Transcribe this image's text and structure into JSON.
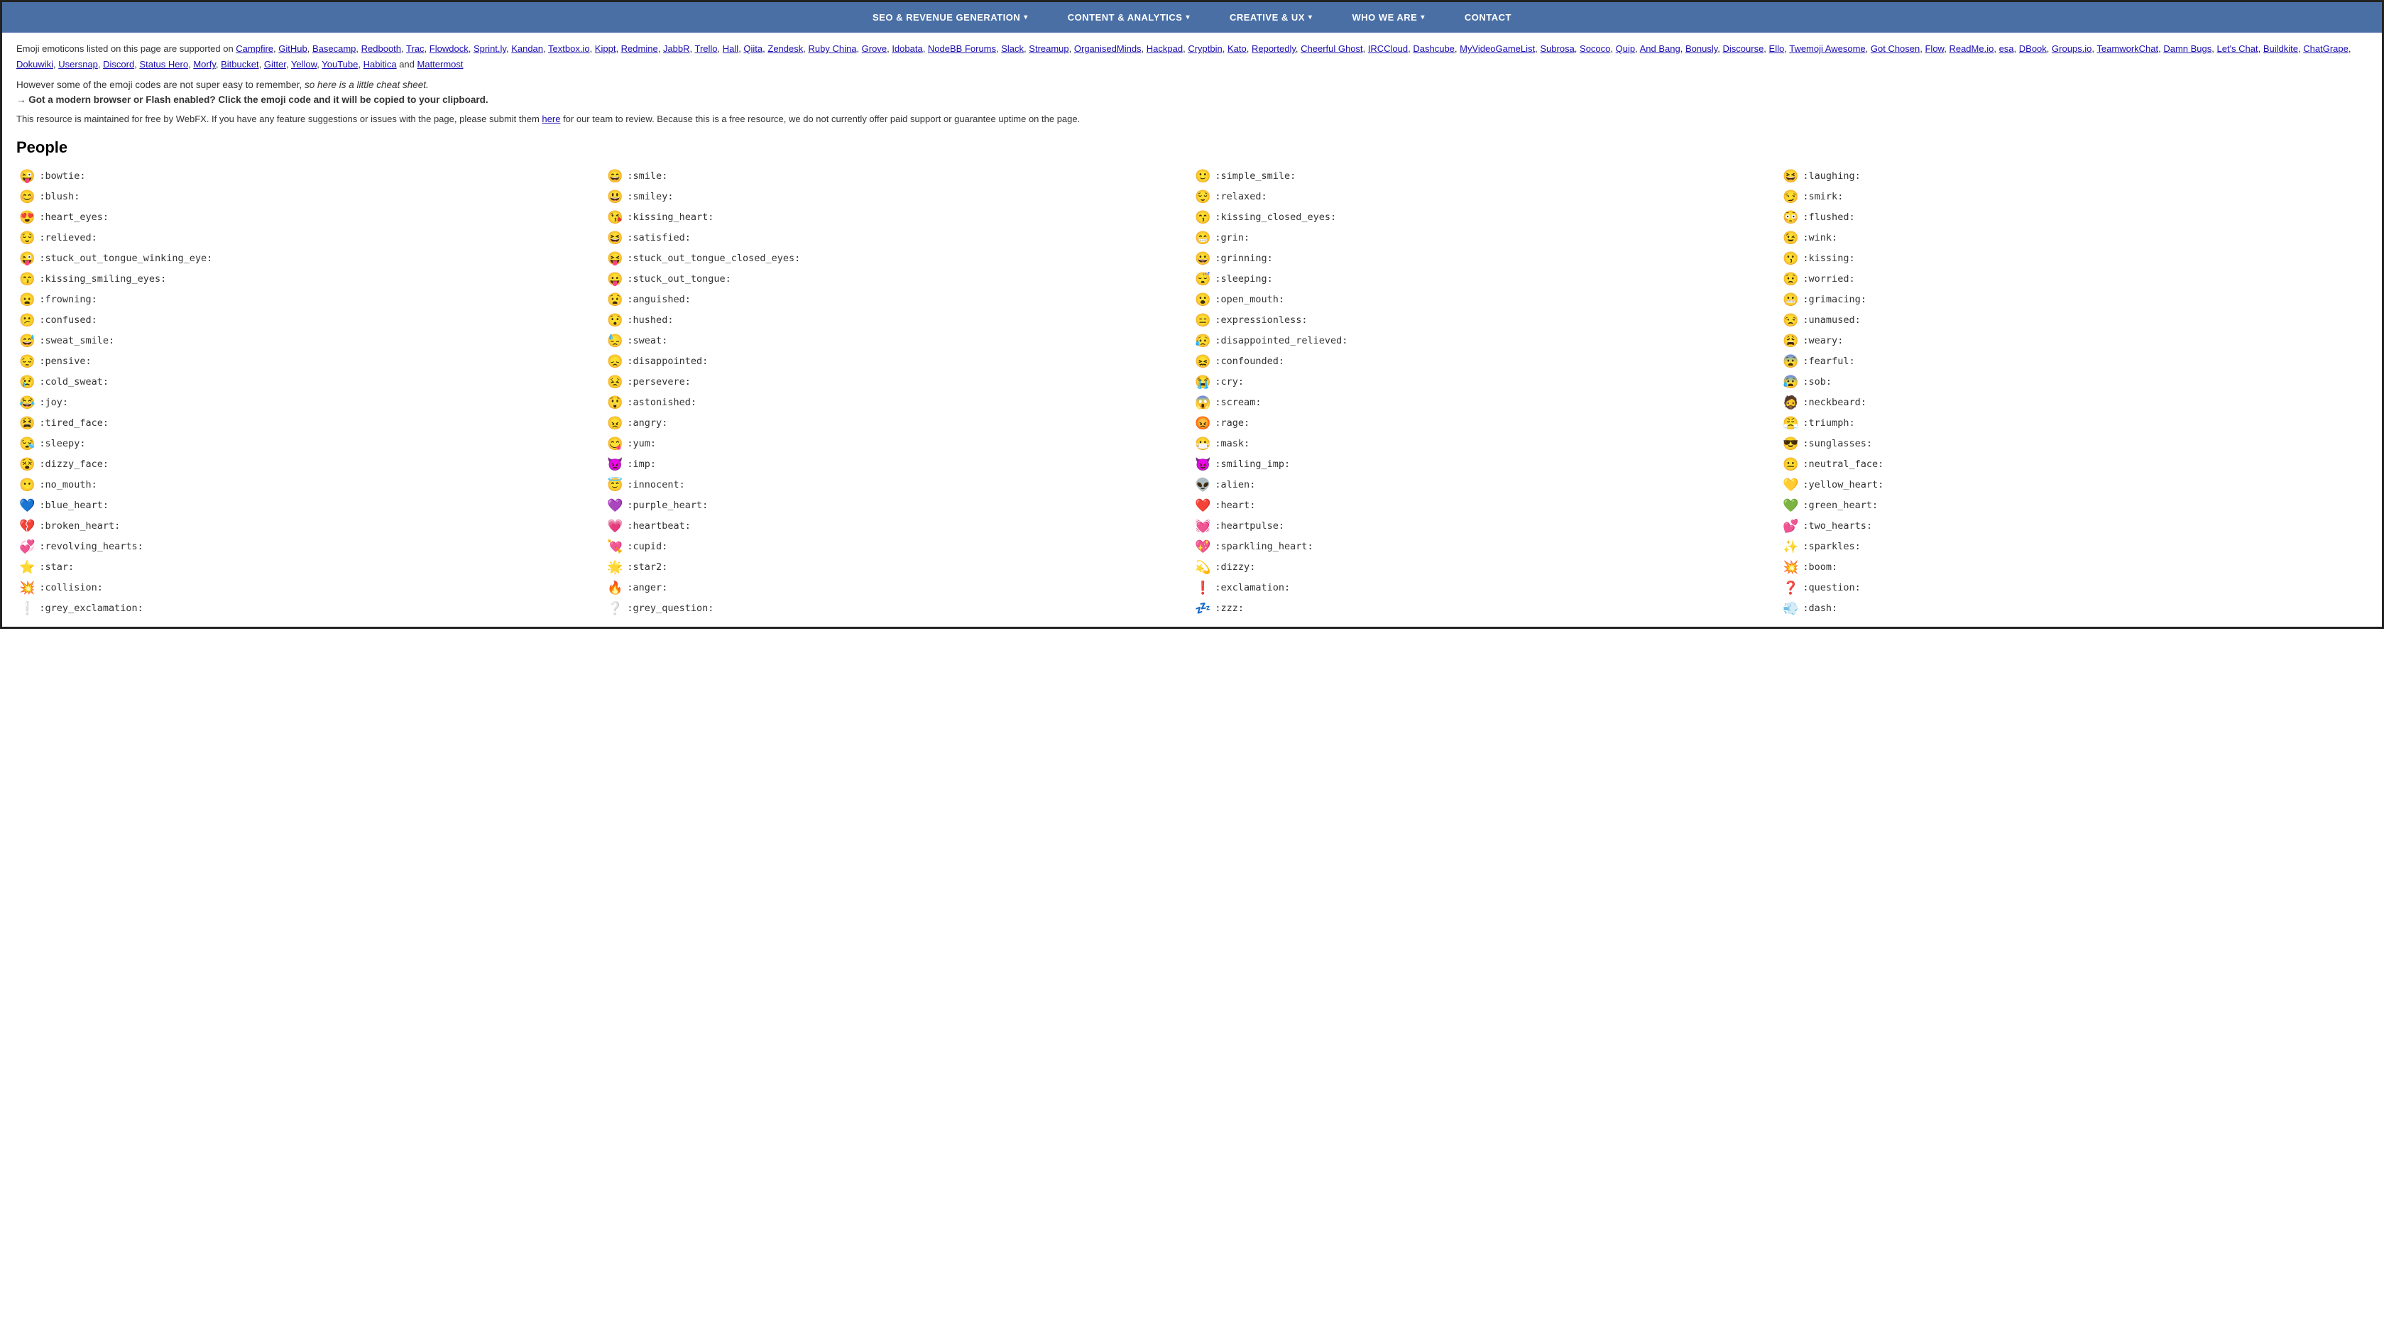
{
  "nav": {
    "items": [
      {
        "label": "SEO & REVENUE GENERATION",
        "has_dropdown": true
      },
      {
        "label": "CONTENT & ANALYTICS",
        "has_dropdown": true
      },
      {
        "label": "CREATIVE & UX",
        "has_dropdown": true
      },
      {
        "label": "WHO WE ARE",
        "has_dropdown": true
      },
      {
        "label": "CONTACT",
        "has_dropdown": false
      }
    ]
  },
  "intro": {
    "prefix": "Emoji emoticons listed on this page are supported on",
    "links": [
      "Campfire",
      "GitHub",
      "Basecamp",
      "Redbooth",
      "Trac",
      "Flowdock",
      "Sprint.ly",
      "Kandan",
      "Textbox.io",
      "Kippt",
      "Redmine",
      "JabbR",
      "Trello",
      "Hall",
      "Qiita",
      "Zendesk",
      "Ruby China",
      "Grove",
      "Idobata",
      "NodeBB Forums",
      "Slack",
      "Streamup",
      "OrganisedMinds",
      "Hackpad",
      "Cryptbin",
      "Kato",
      "Reportedly",
      "Cheerful Ghost",
      "IRCCloud",
      "Dashcube",
      "MyVideoGameList",
      "Subrosa",
      "Sococo",
      "Quip",
      "And Bang",
      "Bonusly",
      "Discourse",
      "Ello",
      "Twemoji Awesome",
      "Got Chosen",
      "Flow",
      "ReadMe.io",
      "esa",
      "DBook",
      "Groups.io",
      "TeamworkChat",
      "Damn Bugs",
      "Let's Chat",
      "Buildkite",
      "ChatGrape",
      "Dokuwiki",
      "Usersnap",
      "Discord",
      "Status Hero",
      "Morfy",
      "Bitbucket",
      "Gitter",
      "Yellow",
      "YouTube",
      "Habitica",
      "Mattermost"
    ],
    "cheat_note": "However some of the emoji codes are not super easy to remember,",
    "cheat_italic": "so here is a little cheat sheet.",
    "arrow_text": "Got a modern browser or Flash enabled? Click the emoji code and it will be copied to your clipboard.",
    "resource_text": "This resource is maintained for free by WebFX. If you have any feature suggestions or issues with the page, please submit them",
    "resource_link_text": "here",
    "resource_suffix": "for our team to review. Because this is a free resource, we do not currently offer paid support or guarantee uptime on the page."
  },
  "section": {
    "title": "People"
  },
  "emojis": [
    {
      "em": "😜",
      "code": ":bowtie:"
    },
    {
      "em": "😄",
      "code": ":smile:"
    },
    {
      "em": "🙂",
      "code": ":simple_smile:"
    },
    {
      "em": "😆",
      "code": ":laughing:"
    },
    {
      "em": "😊",
      "code": ":blush:"
    },
    {
      "em": "😃",
      "code": ":smiley:"
    },
    {
      "em": "😌",
      "code": ":relaxed:"
    },
    {
      "em": "😏",
      "code": ":smirk:"
    },
    {
      "em": "😍",
      "code": ":heart_eyes:"
    },
    {
      "em": "😘",
      "code": ":kissing_heart:"
    },
    {
      "em": "😙",
      "code": ":kissing_closed_eyes:"
    },
    {
      "em": "😳",
      "code": ":flushed:"
    },
    {
      "em": "😌",
      "code": ":relieved:"
    },
    {
      "em": "😆",
      "code": ":satisfied:"
    },
    {
      "em": "😁",
      "code": ":grin:"
    },
    {
      "em": "😉",
      "code": ":wink:"
    },
    {
      "em": "😜",
      "code": ":stuck_out_tongue_winking_eye:"
    },
    {
      "em": "😝",
      "code": ":stuck_out_tongue_closed_eyes:"
    },
    {
      "em": "😀",
      "code": ":grinning:"
    },
    {
      "em": "😗",
      "code": ":kissing:"
    },
    {
      "em": "😙",
      "code": ":kissing_smiling_eyes:"
    },
    {
      "em": "😛",
      "code": ":stuck_out_tongue:"
    },
    {
      "em": "😴",
      "code": ":sleeping:"
    },
    {
      "em": "😟",
      "code": ":worried:"
    },
    {
      "em": "😦",
      "code": ":frowning:"
    },
    {
      "em": "😧",
      "code": ":anguished:"
    },
    {
      "em": "😮",
      "code": ":open_mouth:"
    },
    {
      "em": "😬",
      "code": ":grimacing:"
    },
    {
      "em": "😕",
      "code": ":confused:"
    },
    {
      "em": "😯",
      "code": ":hushed:"
    },
    {
      "em": "😑",
      "code": ":expressionless:"
    },
    {
      "em": "😒",
      "code": ":unamused:"
    },
    {
      "em": "😅",
      "code": ":sweat_smile:"
    },
    {
      "em": "😓",
      "code": ":sweat:"
    },
    {
      "em": "😥",
      "code": ":disappointed_relieved:"
    },
    {
      "em": "😩",
      "code": ":weary:"
    },
    {
      "em": "😔",
      "code": ":pensive:"
    },
    {
      "em": "😞",
      "code": ":disappointed:"
    },
    {
      "em": "😖",
      "code": ":confounded:"
    },
    {
      "em": "😨",
      "code": ":fearful:"
    },
    {
      "em": "😢",
      "code": ":cold_sweat:"
    },
    {
      "em": "😣",
      "code": ":persevere:"
    },
    {
      "em": "😭",
      "code": ":cry:"
    },
    {
      "em": "😰",
      "code": ":sob:"
    },
    {
      "em": "😂",
      "code": ":joy:"
    },
    {
      "em": "😲",
      "code": ":astonished:"
    },
    {
      "em": "😱",
      "code": ":scream:"
    },
    {
      "em": "🧔",
      "code": ":neckbeard:"
    },
    {
      "em": "😫",
      "code": ":tired_face:"
    },
    {
      "em": "😠",
      "code": ":angry:"
    },
    {
      "em": "😡",
      "code": ":rage:"
    },
    {
      "em": "😤",
      "code": ":triumph:"
    },
    {
      "em": "😪",
      "code": ":sleepy:"
    },
    {
      "em": "😋",
      "code": ":yum:"
    },
    {
      "em": "😷",
      "code": ":mask:"
    },
    {
      "em": "😎",
      "code": ":sunglasses:"
    },
    {
      "em": "😵",
      "code": ":dizzy_face:"
    },
    {
      "em": "👿",
      "code": ":imp:"
    },
    {
      "em": "😈",
      "code": ":smiling_imp:"
    },
    {
      "em": "😐",
      "code": ":neutral_face:"
    },
    {
      "em": "😶",
      "code": ":no_mouth:"
    },
    {
      "em": "😇",
      "code": ":innocent:"
    },
    {
      "em": "👽",
      "code": ":alien:"
    },
    {
      "em": "💛",
      "code": ":yellow_heart:"
    },
    {
      "em": "💙",
      "code": ":blue_heart:"
    },
    {
      "em": "💜",
      "code": ":purple_heart:"
    },
    {
      "em": "❤️",
      "code": ":heart:"
    },
    {
      "em": "💚",
      "code": ":green_heart:"
    },
    {
      "em": "💔",
      "code": ":broken_heart:"
    },
    {
      "em": "💗",
      "code": ":heartbeat:"
    },
    {
      "em": "💓",
      "code": ":heartpulse:"
    },
    {
      "em": "💕",
      "code": ":two_hearts:"
    },
    {
      "em": "💞",
      "code": ":revolving_hearts:"
    },
    {
      "em": "💘",
      "code": ":cupid:"
    },
    {
      "em": "💖",
      "code": ":sparkling_heart:"
    },
    {
      "em": "✨",
      "code": ":sparkles:"
    },
    {
      "em": "⭐",
      "code": ":star:"
    },
    {
      "em": "🌟",
      "code": ":star2:"
    },
    {
      "em": "💫",
      "code": ":dizzy:"
    },
    {
      "em": "💥",
      "code": ":boom:"
    },
    {
      "em": "💥",
      "code": ":collision:"
    },
    {
      "em": "🔥",
      "code": ":anger:"
    },
    {
      "em": "❗",
      "code": ":exclamation:"
    },
    {
      "em": "❓",
      "code": ":question:"
    },
    {
      "em": "❕",
      "code": ":grey_exclamation:"
    },
    {
      "em": "❔",
      "code": ":grey_question:"
    },
    {
      "em": "💤",
      "code": ":zzz:"
    },
    {
      "em": "💨",
      "code": ":dash:"
    }
  ]
}
